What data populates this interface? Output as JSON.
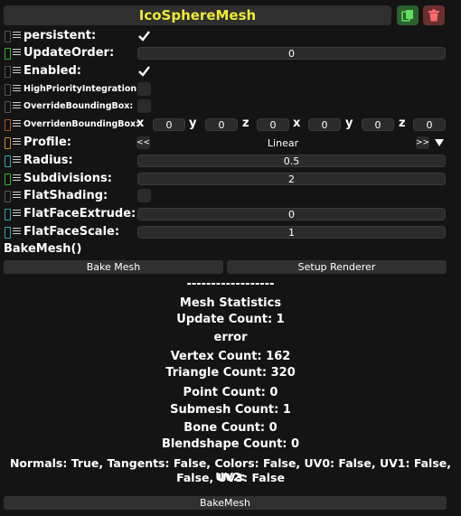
{
  "header": {
    "title": "IcoSphereMesh",
    "duplicate_icon": "copy-icon",
    "delete_icon": "trash-icon"
  },
  "fields": {
    "persistent": {
      "label": "persistent:",
      "checked": true
    },
    "update_order": {
      "label": "UpdateOrder:",
      "value": "0"
    },
    "enabled": {
      "label": "Enabled:",
      "checked": true
    },
    "high_priority": {
      "label": "HighPriorityIntegration:",
      "checked": false
    },
    "override_bbox": {
      "label": "OverrideBoundingBox:",
      "checked": false
    },
    "overriden_bbox": {
      "label": "OverridenBoundingBox:",
      "min": {
        "x_label": "x",
        "x": "0",
        "y_label": "y",
        "y": "0",
        "z_label": "z",
        "z": "0"
      },
      "max": {
        "x_label": "x",
        "x": "0",
        "y_label": "y",
        "y": "0",
        "z_label": "z",
        "z": "0"
      }
    },
    "profile": {
      "label": "Profile:",
      "prev": "<<",
      "value": "Linear",
      "next": ">>"
    },
    "radius": {
      "label": "Radius:",
      "value": "0.5"
    },
    "subdivisions": {
      "label": "Subdivisions:",
      "value": "2"
    },
    "flat_shading": {
      "label": "FlatShading:",
      "checked": false
    },
    "flat_face_extrude": {
      "label": "FlatFaceExtrude:",
      "value": "0"
    },
    "flat_face_scale": {
      "label": "FlatFaceScale:",
      "value": "1"
    }
  },
  "bake": {
    "method_label": "BakeMesh()",
    "bake_mesh_button": "Bake Mesh",
    "setup_renderer_button": "Setup Renderer",
    "bottom_button": "BakeMesh"
  },
  "stats": {
    "separator": "------------------",
    "heading": "Mesh Statistics",
    "update_count": "Update Count: 1",
    "error": "error",
    "vertex_count": "Vertex Count: 162",
    "triangle_count": "Triangle Count: 320",
    "point_count": "Point Count: 0",
    "submesh_count": "Submesh Count: 1",
    "bone_count": "Bone Count: 0",
    "blendshape_count": "Blendshape Count: 0",
    "attributes_line1": "Normals: True, Tangents: False, Colors: False, UV0: False, UV1: False, UV2:",
    "attributes_line2": "False, UV3: False"
  },
  "colors": {
    "title": "#eee934",
    "handle_bool": "#666666",
    "handle_int": "#2fb82f",
    "handle_float": "#2fa8a8",
    "handle_vector": "#b05a2a",
    "handle_enum": "#c98c2a"
  }
}
